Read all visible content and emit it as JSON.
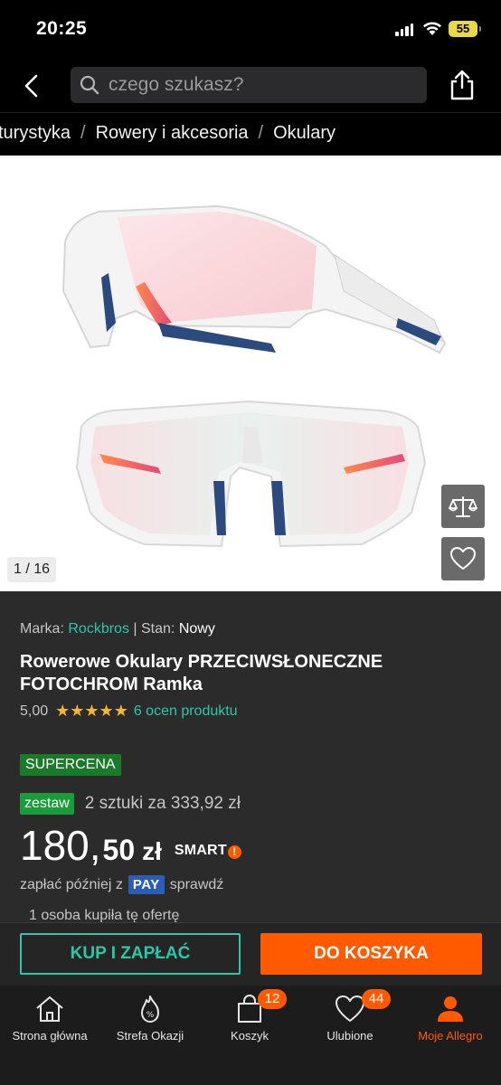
{
  "status_bar": {
    "time": "20:25",
    "battery": "55"
  },
  "header": {
    "search_placeholder": "czego szukasz?"
  },
  "breadcrumb": [
    "turystyka",
    "Rowery i akcesoria",
    "Okulary"
  ],
  "gallery": {
    "counter": "1 / 16"
  },
  "product": {
    "brand_label": "Marka:",
    "brand": "Rockbros",
    "separator": "|",
    "condition_label": "Stan:",
    "condition": "Nowy",
    "title": "Rowerowe Okulary PRZECIWSŁONECZNE FOTOCHROM Ramka",
    "rating": "5,00",
    "stars": "★★★★★",
    "reviews": "6 ocen produktu",
    "supercena": "SUPERCENA",
    "set_badge": "zestaw",
    "set_text": "2 sztuki za 333,92 zł",
    "price_int": "180,",
    "price_frac": "50",
    "currency": "zł",
    "smart": "SMART",
    "pay_later_prefix": "zapłać później z",
    "pay_badge": "PAY",
    "pay_later_suffix": "sprawdź",
    "bought": "1 osoba kupiła tę ofertę"
  },
  "actions": {
    "buy_now": "KUP I ZAPŁAĆ",
    "add_to_cart": "DO KOSZYKA"
  },
  "tabbar": {
    "items": [
      {
        "label": "Strona główna",
        "icon": "home-icon"
      },
      {
        "label": "Strefa Okazji",
        "icon": "deals-flame-icon"
      },
      {
        "label": "Koszyk",
        "icon": "cart-bag-icon",
        "badge": "12"
      },
      {
        "label": "Ulubione",
        "icon": "heart-icon",
        "badge": "44"
      },
      {
        "label": "Moje Allegro",
        "icon": "user-icon"
      }
    ]
  },
  "colors": {
    "accent_orange": "#ff5a00",
    "accent_teal": "#2cc7a8",
    "star": "#f7b62c"
  }
}
